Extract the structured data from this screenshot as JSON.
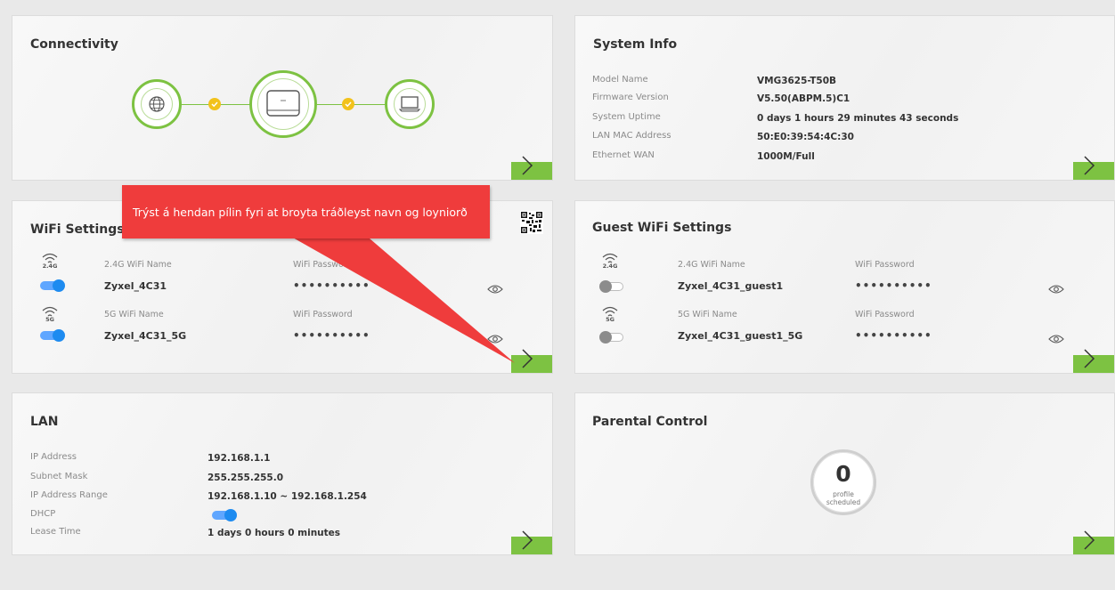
{
  "connectivity": {
    "title": "Connectivity"
  },
  "system_info": {
    "title": "System Info",
    "rows": [
      {
        "label": "Model Name",
        "value": "VMG3625-T50B"
      },
      {
        "label": "Firmware Version",
        "value": "V5.50(ABPM.5)C1"
      },
      {
        "label": "System Uptime",
        "value": "0 days 1 hours 29 minutes 43 seconds"
      },
      {
        "label": "LAN MAC Address",
        "value": "50:E0:39:54:4C:30"
      },
      {
        "label": "Ethernet WAN",
        "value": "1000M/Full"
      }
    ]
  },
  "wifi": {
    "title": "WiFi Settings",
    "rows": [
      {
        "band": "2.4G",
        "name_label": "2.4G WiFi Name",
        "name": "Zyxel_4C31",
        "pass_label": "WiFi Password",
        "password": "••••••••••",
        "enabled": true
      },
      {
        "band": "5G",
        "name_label": "5G WiFi Name",
        "name": "Zyxel_4C31_5G",
        "pass_label": "WiFi Password",
        "password": "••••••••••",
        "enabled": true
      }
    ]
  },
  "guest_wifi": {
    "title": "Guest WiFi Settings",
    "rows": [
      {
        "band": "2.4G",
        "name_label": "2.4G WiFi Name",
        "name": "Zyxel_4C31_guest1",
        "pass_label": "WiFi Password",
        "password": "••••••••••",
        "enabled": false
      },
      {
        "band": "5G",
        "name_label": "5G WiFi Name",
        "name": "Zyxel_4C31_guest1_5G",
        "pass_label": "WiFi Password",
        "password": "••••••••••",
        "enabled": false
      }
    ]
  },
  "lan": {
    "title": "LAN",
    "rows": [
      {
        "label": "IP Address",
        "value": "192.168.1.1"
      },
      {
        "label": "Subnet Mask",
        "value": "255.255.255.0"
      },
      {
        "label": "IP Address Range",
        "value": "192.168.1.10 ~ 192.168.1.254"
      },
      {
        "label": "DHCP",
        "value": ""
      },
      {
        "label": "Lease Time",
        "value": "1 days 0 hours 0 minutes"
      }
    ],
    "dhcp_enabled": true
  },
  "parental": {
    "title": "Parental Control",
    "count": "0",
    "line1": "profile",
    "line2": "scheduled"
  },
  "tooltip": {
    "text": "Trýst á hendan pílin fyri at broyta tráðleyst navn og loyniorð"
  },
  "colors": {
    "accent_green": "#7dc242",
    "toggle_blue": "#1e8bf0",
    "tooltip_red": "#ef3c3c",
    "check_yellow": "#f2c21b"
  }
}
